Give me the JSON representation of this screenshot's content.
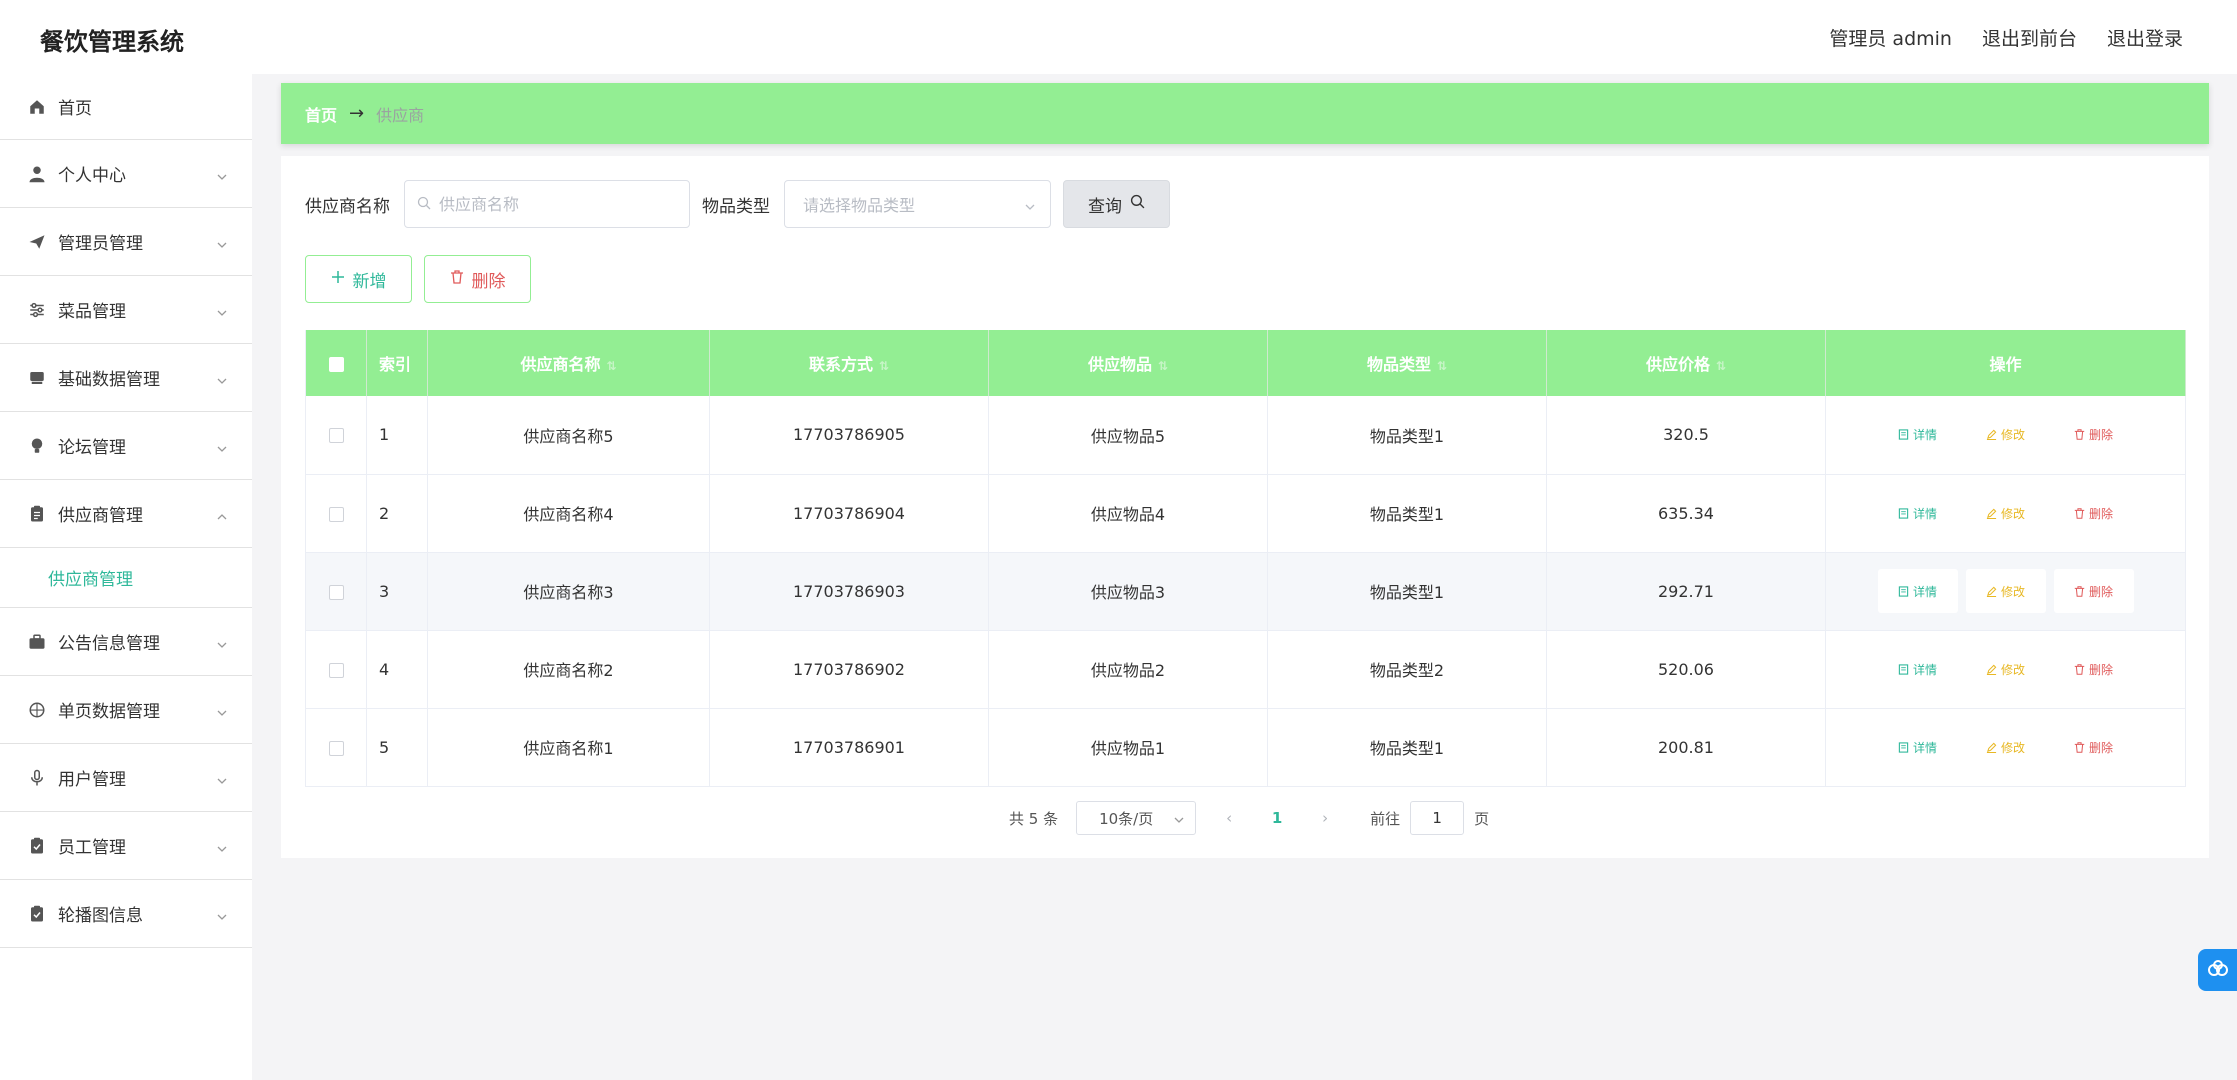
{
  "header": {
    "app_title": "餐饮管理系统",
    "admin_label": "管理员 admin",
    "front_link": "退出到前台",
    "logout_link": "退出登录"
  },
  "sidebar": {
    "items": [
      {
        "label": "首页",
        "icon": "home-icon"
      },
      {
        "label": "个人中心",
        "icon": "user-icon"
      },
      {
        "label": "管理员管理",
        "icon": "send-icon"
      },
      {
        "label": "菜品管理",
        "icon": "sliders-icon"
      },
      {
        "label": "基础数据管理",
        "icon": "drawer-icon"
      },
      {
        "label": "论坛管理",
        "icon": "bulb-icon"
      },
      {
        "label": "供应商管理",
        "icon": "clipboard-icon"
      },
      {
        "label": "公告信息管理",
        "icon": "briefcase-icon"
      },
      {
        "label": "单页数据管理",
        "icon": "globe-icon"
      },
      {
        "label": "用户管理",
        "icon": "mic-icon"
      },
      {
        "label": "员工管理",
        "icon": "clipboard-check-icon"
      },
      {
        "label": "轮播图信息",
        "icon": "clipboard-check-icon"
      }
    ],
    "active_sub_label": "供应商管理"
  },
  "breadcrumb": {
    "home": "首页",
    "arrow": "→",
    "current": "供应商"
  },
  "search": {
    "name_label": "供应商名称",
    "name_placeholder": "供应商名称",
    "type_label": "物品类型",
    "type_placeholder": "请选择物品类型",
    "query_button": "查询"
  },
  "actions": {
    "add_button": "新增",
    "delete_button": "删除"
  },
  "table": {
    "columns": [
      "索引",
      "供应商名称",
      "联系方式",
      "供应物品",
      "物品类型",
      "供应价格",
      "操作"
    ],
    "rows": [
      {
        "index": "1",
        "name": "供应商名称5",
        "phone": "17703786905",
        "item": "供应物品5",
        "type": "物品类型1",
        "price": "320.5"
      },
      {
        "index": "2",
        "name": "供应商名称4",
        "phone": "17703786904",
        "item": "供应物品4",
        "type": "物品类型1",
        "price": "635.34"
      },
      {
        "index": "3",
        "name": "供应商名称3",
        "phone": "17703786903",
        "item": "供应物品3",
        "type": "物品类型1",
        "price": "292.71"
      },
      {
        "index": "4",
        "name": "供应商名称2",
        "phone": "17703786902",
        "item": "供应物品2",
        "type": "物品类型2",
        "price": "520.06"
      },
      {
        "index": "5",
        "name": "供应商名称1",
        "phone": "17703786901",
        "item": "供应物品1",
        "type": "物品类型1",
        "price": "200.81"
      }
    ],
    "op_detail": "详情",
    "op_edit": "修改",
    "op_delete": "删除",
    "highlighted_row": 3
  },
  "pagination": {
    "total": "共 5 条",
    "page_size": "10条/页",
    "current_page": "1",
    "goto_label": "前往",
    "goto_value": "1",
    "page_suffix": "页"
  },
  "colors": {
    "accent_green": "#93ee93",
    "text_teal": "#2fb89a",
    "edit_yellow": "#e8b824",
    "delete_red": "#e05a5a",
    "float_blue": "#1e90f0"
  }
}
